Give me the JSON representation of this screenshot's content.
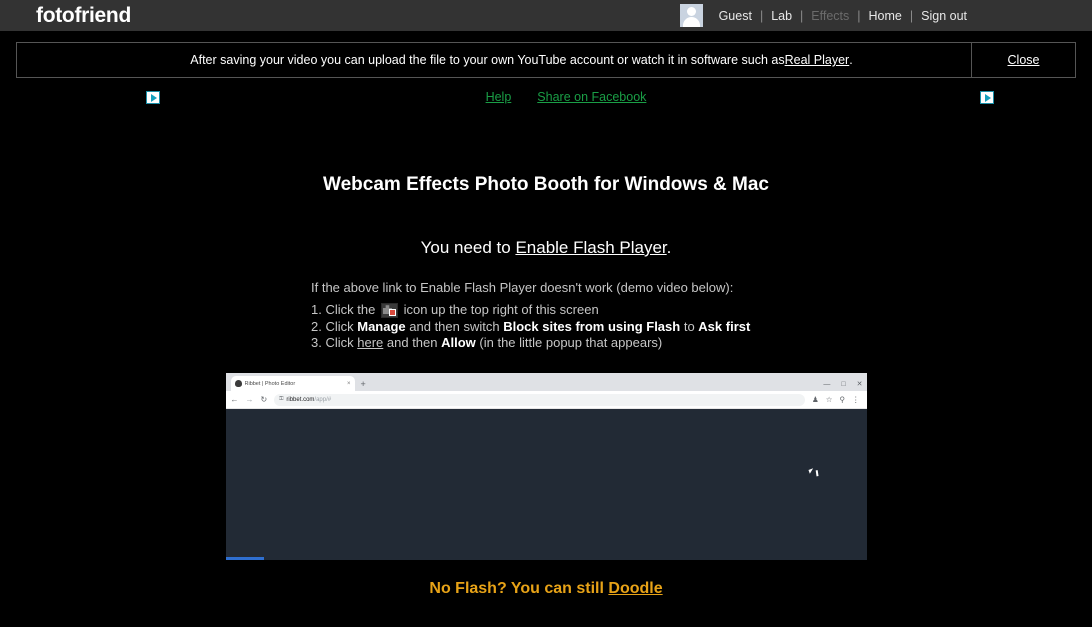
{
  "header": {
    "logo": "fotofriend",
    "avatar_name": "user-avatar",
    "nav": [
      {
        "label": "Guest",
        "disabled": false
      },
      {
        "label": "Lab",
        "disabled": false
      },
      {
        "label": "Effects",
        "disabled": true
      },
      {
        "label": "Home",
        "disabled": false
      },
      {
        "label": "Sign out",
        "disabled": false
      }
    ],
    "separator": "|"
  },
  "notice": {
    "text_before": "After saving your video you can upload the file to your own YouTube account or watch it in software such as ",
    "link": "Real Player",
    "text_after": ".",
    "close_label": "Close"
  },
  "toplinks": {
    "help": "Help",
    "share": "Share on Facebook",
    "adchoices_label": "AdChoices"
  },
  "main": {
    "title": "Webcam Effects Photo Booth for Windows & Mac",
    "subtitle_before": "You need to ",
    "subtitle_link": "Enable Flash Player",
    "subtitle_after": ".",
    "steps_intro": "If the above link to Enable Flash Player doesn't work (demo video below):",
    "step1_num": "1.",
    "step1_a": "Click the",
    "step1_b": "icon up the top right of this screen",
    "step2_num": "2.",
    "step2_a": "Click ",
    "step2_bold1": "Manage",
    "step2_b": " and then switch ",
    "step2_bold2": "Block sites from using Flash",
    "step2_c": " to ",
    "step2_bold3": "Ask first",
    "step3_num": "3.",
    "step3_a": "Click ",
    "step3_link": "here",
    "step3_b": " and then ",
    "step3_bold": "Allow",
    "step3_c": " (in the little popup that appears)"
  },
  "video": {
    "tab_title": "Ribbet | Photo Editor",
    "tab_close": "×",
    "new_tab": "+",
    "win_min": "—",
    "win_max": "□",
    "win_close": "✕",
    "back": "←",
    "forward": "→",
    "reload": "↻",
    "lock": "ὑ2",
    "url_domain": "ribbet.com",
    "url_path": "/app/#",
    "ext_icon": "♟",
    "star_icon": "☆",
    "profile_icon": "⚲",
    "menu_icon": "⋮",
    "progress_percent": "6"
  },
  "footer": {
    "doodle_before": "No Flash? You can still ",
    "doodle_link": "Doodle"
  },
  "colors": {
    "header_bg": "#333333",
    "page_bg": "#000000",
    "green_link": "#1a9e46",
    "doodle_orange": "#e8a317",
    "progress_blue": "#2f6fd0"
  }
}
